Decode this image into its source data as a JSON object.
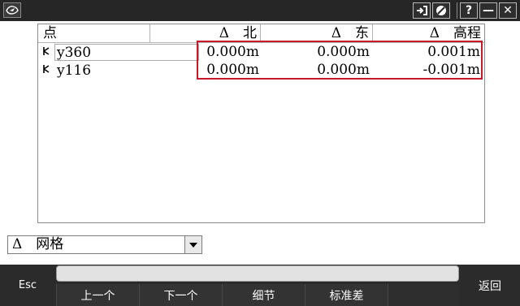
{
  "title_bar": {
    "logo_icon": "app-logo-icon",
    "buttons": [
      {
        "name": "login-icon"
      },
      {
        "name": "no-entry-icon"
      },
      {
        "label": "?"
      },
      {
        "label": "—"
      },
      {
        "label": "✕"
      }
    ]
  },
  "table": {
    "columns": [
      "点",
      "Δ　北",
      "Δ　东",
      "Δ　高程"
    ],
    "rows": [
      {
        "point": "y360",
        "d_north": "0.000m",
        "d_east": "0.000m",
        "d_height": "0.001m"
      },
      {
        "point": "y116",
        "d_north": "0.000m",
        "d_east": "0.000m",
        "d_height": "-0.001m"
      }
    ]
  },
  "dropdown": {
    "value": "Δ　网格"
  },
  "bottom_bar": {
    "esc_label": "Esc",
    "back_label": "返回",
    "softkeys": [
      "上一个",
      "下一个",
      "细节",
      "标准差",
      ""
    ]
  },
  "colors": {
    "title_bar": "#262626",
    "bottom_bar": "#2b2b2b",
    "highlight": "#c8182a"
  }
}
